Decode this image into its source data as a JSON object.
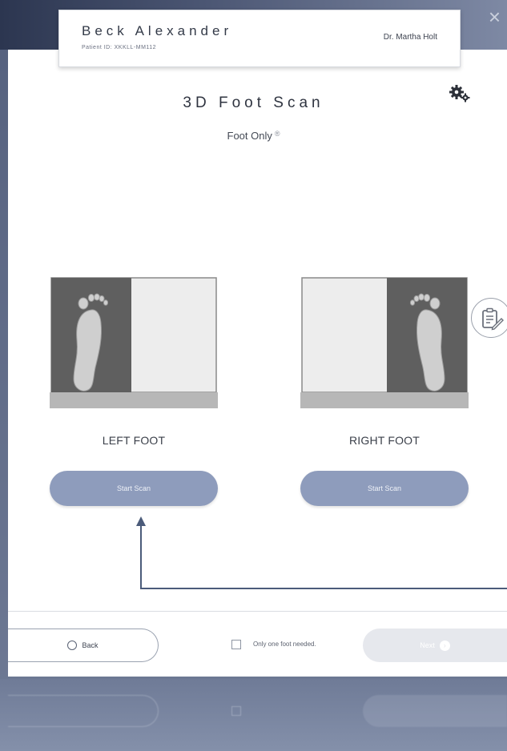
{
  "window": {
    "close_symbol": "×"
  },
  "patient": {
    "name": "Beck Alexander",
    "id_line": "Patient ID: XKKLL-MM112",
    "doctor": "Dr. Martha Holt"
  },
  "scan": {
    "title": "3D Foot Scan",
    "mode": "Foot Only",
    "mode_marker": "®"
  },
  "feet": {
    "left": {
      "label": "LEFT FOOT",
      "button": "Start Scan"
    },
    "right": {
      "label": "RIGHT FOOT",
      "button": "Start Scan"
    }
  },
  "footer": {
    "back_label": "Back",
    "checkbox_label": "Only one foot needed.",
    "next_label": "Next"
  },
  "icons": {
    "settings": "gears-icon",
    "notes": "clipboard-edit-icon",
    "back": "back-arrow-icon",
    "next": "next-arrow-icon"
  },
  "colors": {
    "accent_button": "#8e9cbc",
    "pad_dark": "#5f5f5f",
    "pad_light": "#eeeeee",
    "pad_base": "#b7b7b7",
    "annotation_arrow": "#4b5b7a"
  }
}
